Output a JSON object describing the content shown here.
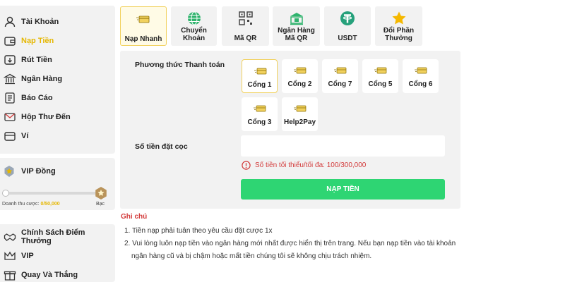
{
  "sidebar": {
    "menu": [
      {
        "label": "Tài Khoản",
        "icon": "user-icon"
      },
      {
        "label": "Nạp Tiền",
        "icon": "wallet-icon",
        "active": true
      },
      {
        "label": "Rút Tiền",
        "icon": "withdraw-icon"
      },
      {
        "label": "Ngân Hàng",
        "icon": "bank-icon"
      },
      {
        "label": "Báo Cáo",
        "icon": "report-icon"
      },
      {
        "label": "Hộp Thư Đến",
        "icon": "mail-icon"
      },
      {
        "label": "Ví",
        "icon": "wallet-card-icon"
      }
    ],
    "vip": {
      "title": "VIP Đồng",
      "revenue_label": "Doanh thu cược:",
      "revenue_value": "0/50,000",
      "progress": 0,
      "next_tier": "Bạc"
    },
    "more": [
      {
        "label": "Chính Sách Điểm Thưởng",
        "icon": "handshake-icon"
      },
      {
        "label": "VIP",
        "icon": "crown-icon"
      },
      {
        "label": "Quay Và Thắng",
        "icon": "gift-icon"
      }
    ]
  },
  "tabs": [
    {
      "label": "Nạp Nhanh",
      "icon": "card-icon",
      "active": true
    },
    {
      "label": "Chuyển Khoản",
      "icon": "globe-icon"
    },
    {
      "label": "Mã QR",
      "icon": "qr-icon"
    },
    {
      "label": "Ngân Hàng Mã QR",
      "icon": "bank-qr-icon"
    },
    {
      "label": "USDT",
      "icon": "tether-icon"
    },
    {
      "label": "Đổi Phần Thưởng",
      "icon": "star-icon"
    }
  ],
  "form": {
    "method_label": "Phương thức Thanh toán",
    "gates": [
      "Cổng 1",
      "Cổng 2",
      "Cổng 7",
      "Cổng 5",
      "Cổng 6",
      "Cổng 3",
      "Help2Pay"
    ],
    "selected_gate": "Cổng 1",
    "amount_label": "Số tiền đặt cọc",
    "amount_value": "",
    "amount_placeholder": "",
    "hint": "Số tiền tối thiểu/tối đa: 100/300,000",
    "submit": "NẠP TIỀN"
  },
  "notes": {
    "title": "Ghi chú",
    "items": [
      "1. Tiền nạp phải tuân theo yêu cầu đặt cược 1x",
      "2. Vui lòng luôn nạp tiền vào ngân hàng mới nhất được hiển thị trên trang. Nếu bạn nạp tiền vào tài khoản",
      "ngân hàng cũ và bị chậm hoặc mất tiền chúng tôi sẽ không chịu trách nhiệm."
    ]
  },
  "colors": {
    "accent": "#e5b700",
    "submit": "#2ed573",
    "error": "#d33b3b",
    "panel": "#f2f2f2"
  }
}
